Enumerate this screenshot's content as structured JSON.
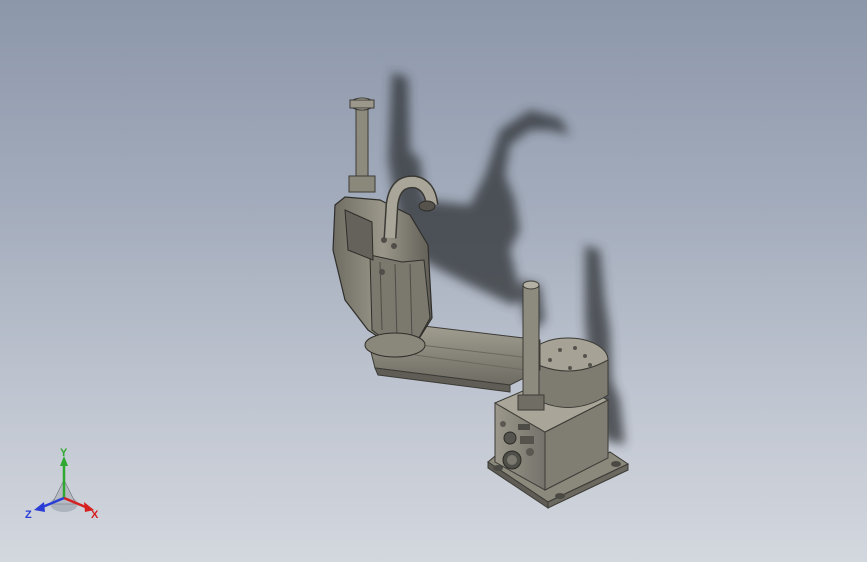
{
  "viewport": {
    "background_top": "#8c97aa",
    "background_bottom": "#d3d7de"
  },
  "model": {
    "body_color": "#8a877a",
    "shadow_color": "#2f3236"
  },
  "triad": {
    "x_label": "X",
    "y_label": "Y",
    "z_label": "Z",
    "x_color": "#d62020",
    "y_color": "#2fa82f",
    "z_color": "#2a3ed6"
  }
}
